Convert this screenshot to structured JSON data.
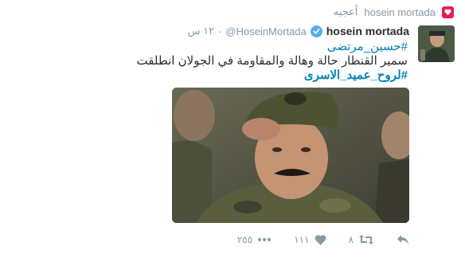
{
  "liked_row": {
    "user": "hosein mortada",
    "action": "أعجبه",
    "icon": "heart-icon",
    "color": "#e81c4f"
  },
  "tweet": {
    "display_name": "hosein mortada",
    "handle": "@HoseinMortada",
    "time": "١٢ س",
    "verified_icon": "verified-badge-icon",
    "text": {
      "hashtag_line": "#حسين_مرتضى",
      "body_line": "سمير القنطار حالة وهالة والمقاومة في الجولان انطلقت",
      "hashtag_bold": "#لروح_عميد_الاسرى"
    },
    "media_alt": "photo"
  },
  "actions": {
    "reply": {
      "icon": "reply-icon"
    },
    "retweet": {
      "icon": "retweet-icon",
      "count": "٨"
    },
    "like": {
      "icon": "heart-icon",
      "count": "١١١"
    },
    "more": {
      "icon": "more-icon",
      "count": "٢٥٥"
    }
  },
  "colors": {
    "accent": "#0084b4",
    "muted": "#8899a6",
    "verified": "#55acee",
    "like": "#e81c4f"
  }
}
